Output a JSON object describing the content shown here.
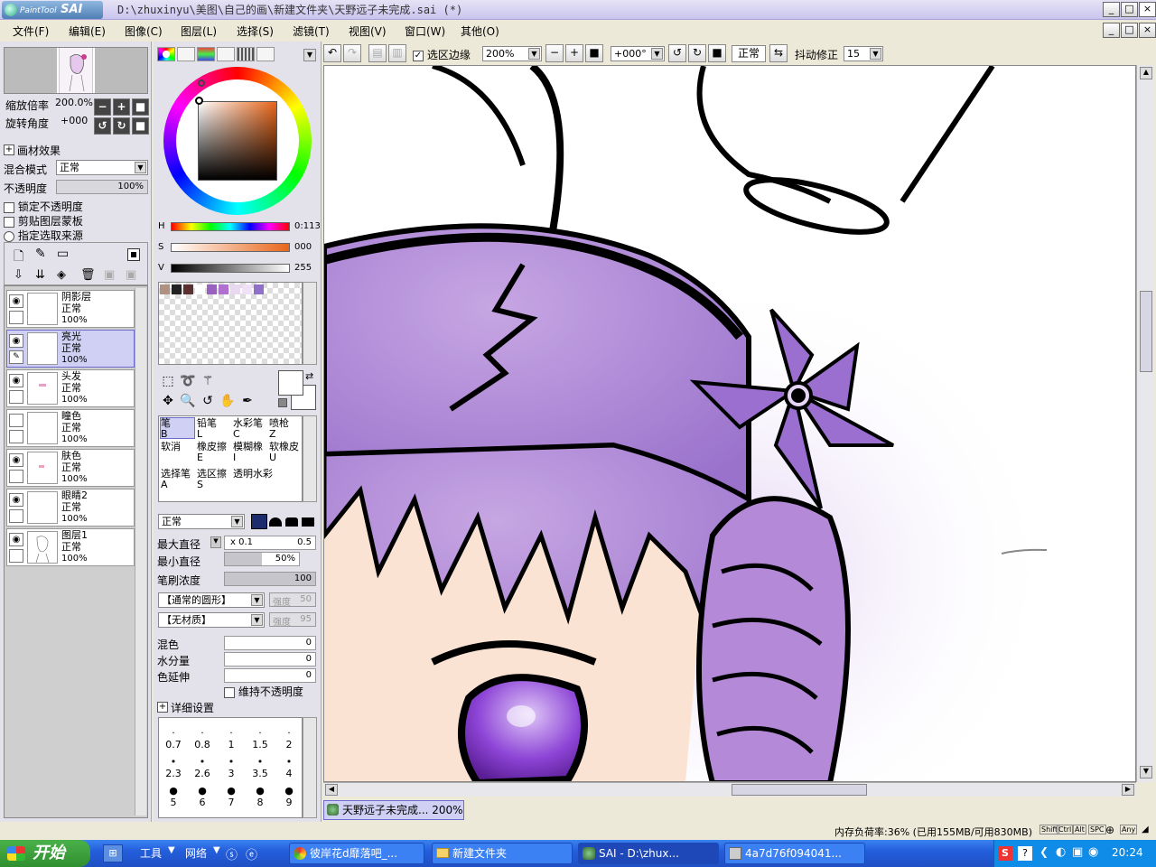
{
  "window": {
    "logo_small": "PaintTool",
    "logo_big": "SAI",
    "title": "D:\\zhuxinyu\\美图\\自己的画\\新建文件夹\\天野远子未完成.sai (*)"
  },
  "menu": [
    "文件(F)",
    "编辑(E)",
    "图像(C)",
    "图层(L)",
    "选择(S)",
    "滤镜(T)",
    "视图(V)",
    "窗口(W)",
    "其他(O)"
  ],
  "navigator": {
    "zoom_label": "缩放倍率",
    "zoom_value": "200.0%",
    "rotate_label": "旋转角度",
    "rotate_value": "+000"
  },
  "layer_props": {
    "paper_effect": "画材效果",
    "blend_label": "混合模式",
    "blend_value": "正常",
    "opacity_label": "不透明度",
    "opacity_value": "100%",
    "lock_opacity": "锁定不透明度",
    "clip_group": "剪贴图层蒙板",
    "selection_source": "指定选取来源"
  },
  "layers": [
    {
      "name": "阴影层",
      "mode": "正常",
      "opacity": "100%",
      "visible": true
    },
    {
      "name": "亮光",
      "mode": "正常",
      "opacity": "100%",
      "visible": true,
      "selected": true
    },
    {
      "name": "头发",
      "mode": "正常",
      "opacity": "100%",
      "visible": true
    },
    {
      "name": "瞳色",
      "mode": "正常",
      "opacity": "100%",
      "visible": false
    },
    {
      "name": "肤色",
      "mode": "正常",
      "opacity": "100%",
      "visible": true
    },
    {
      "name": "眼睛2",
      "mode": "正常",
      "opacity": "100%",
      "visible": true
    },
    {
      "name": "图层1",
      "mode": "正常",
      "opacity": "100%",
      "visible": true
    }
  ],
  "color": {
    "h_label": "H",
    "h_value": "0:113",
    "s_label": "S",
    "s_value": "000",
    "v_label": "V",
    "v_value": "255",
    "swatches": [
      "#b09080",
      "#222222",
      "#5a3030",
      "#ffffff",
      "#9a60c0",
      "#b070d0",
      "#e8d8f0",
      "#f0e0f8",
      "#9070c8"
    ]
  },
  "tools": {
    "row1": [
      {
        "name": "笔",
        "key": "B"
      },
      {
        "name": "铅笔",
        "key": "L"
      },
      {
        "name": "水彩笔",
        "key": "C"
      },
      {
        "name": "喷枪",
        "key": "Z"
      }
    ],
    "row2": [
      {
        "name": "软消",
        "key": ""
      },
      {
        "name": "橡皮擦",
        "key": "E"
      },
      {
        "name": "模糊橡",
        "key": "I"
      },
      {
        "name": "软橡皮",
        "key": "U"
      }
    ],
    "row3": [
      {
        "name": "选择笔",
        "key": "A"
      },
      {
        "name": "选区擦",
        "key": "S"
      },
      {
        "name": "透明水彩",
        "key": ""
      }
    ]
  },
  "brush": {
    "mode": "正常",
    "max_size_label": "最大直径",
    "max_size_mult": "x 0.1",
    "max_size_value": "0.5",
    "min_size_label": "最小直径",
    "min_size_value": "50%",
    "density_label": "笔刷浓度",
    "density_value": "100",
    "shape": "【通常的圆形】",
    "shape_strength_label": "强度",
    "shape_strength": "50",
    "texture": "【无材质】",
    "texture_strength_label": "强度",
    "texture_strength": "95",
    "blend_label": "混色",
    "blend_value": "0",
    "water_label": "水分量",
    "water_value": "0",
    "stretch_label": "色延伸",
    "stretch_value": "0",
    "keep_opacity": "维持不透明度",
    "detail": "详细设置",
    "sizes": [
      "0.7",
      "0.8",
      "1",
      "1.5",
      "2",
      "2.3",
      "2.6",
      "3",
      "3.5",
      "4",
      "5",
      "6",
      "7",
      "8",
      "9"
    ]
  },
  "toolbar": {
    "sel_edge": "选区边缘",
    "zoom": "200%",
    "angle": "+000°",
    "mode": "正常",
    "stab_label": "抖动修正",
    "stab_value": "15"
  },
  "document_tab": "天野远子未完成... 200%",
  "status": {
    "memory": "内存负荷率:36% (已用155MB/可用830MB)",
    "keys": [
      "Shift",
      "Ctrl",
      "Alt",
      "SPC",
      "Any"
    ]
  },
  "taskbar": {
    "start": "开始",
    "tools_label": "工具",
    "network_label": "网络",
    "tasks": [
      {
        "label": "彼岸花d靡落吧_...",
        "active": false
      },
      {
        "label": "新建文件夹",
        "active": false
      },
      {
        "label": "SAI - D:\\zhux...",
        "active": true
      },
      {
        "label": "4a7d76f094041...",
        "active": false
      }
    ],
    "clock": "20:24"
  }
}
